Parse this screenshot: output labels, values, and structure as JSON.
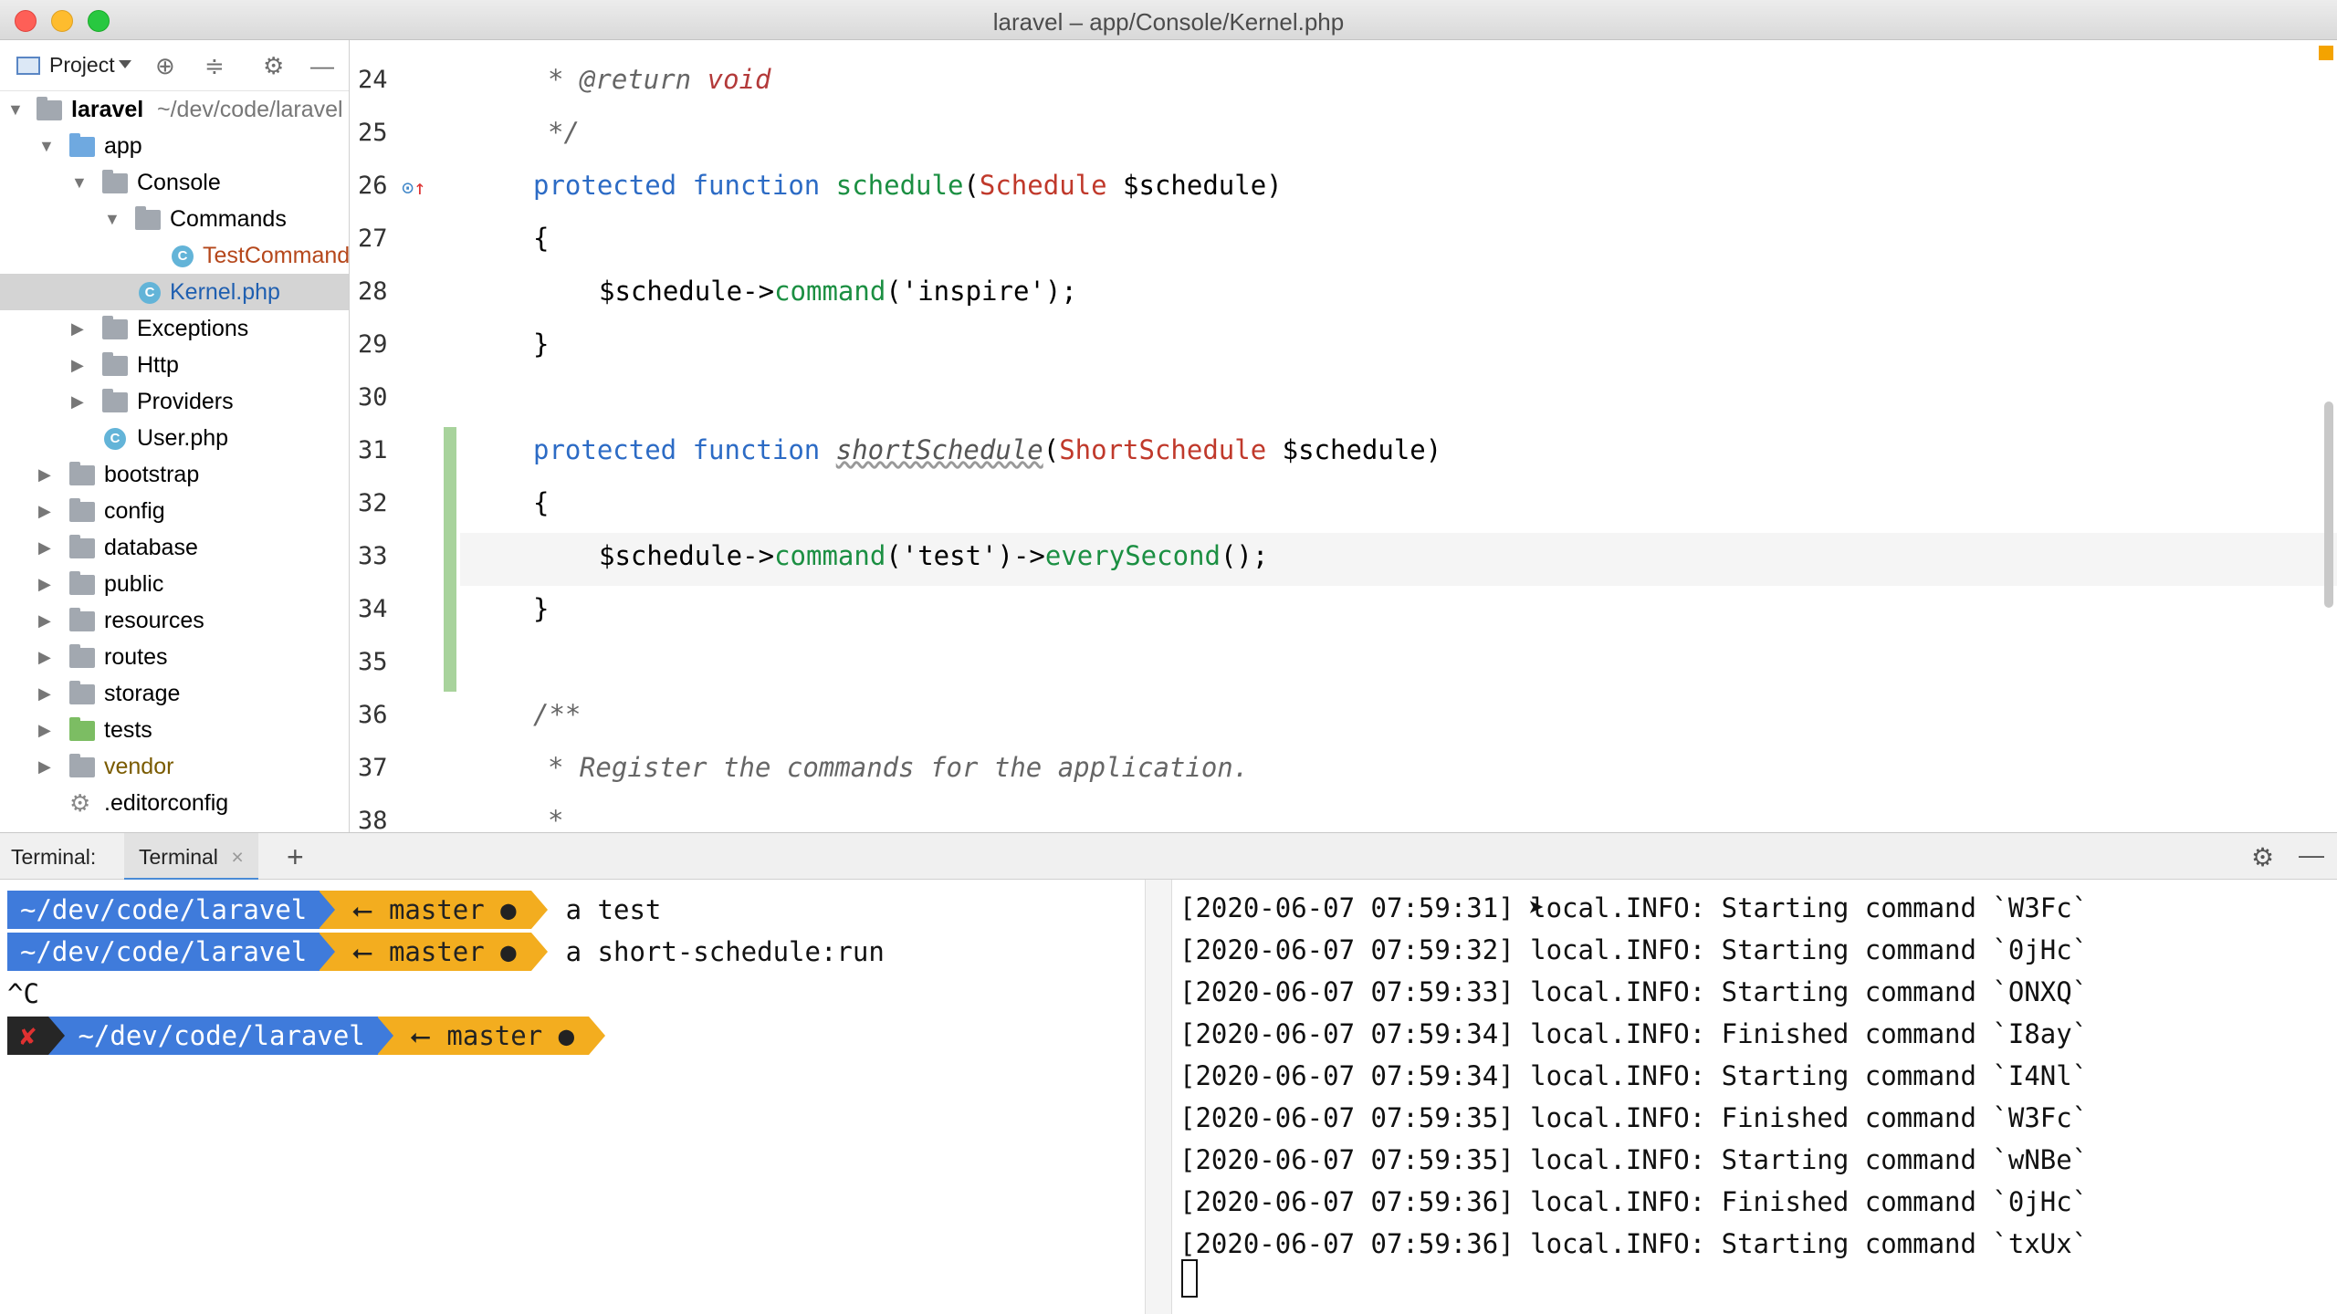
{
  "window": {
    "title": "laravel – app/Console/Kernel.php"
  },
  "sidebar": {
    "view_label": "Project",
    "tree": [
      {
        "label": "laravel",
        "path": "~/dev/code/laravel",
        "type": "root"
      },
      {
        "label": "app"
      },
      {
        "label": "Console"
      },
      {
        "label": "Commands"
      },
      {
        "label": "TestCommand"
      },
      {
        "label": "Kernel.php"
      },
      {
        "label": "Exceptions"
      },
      {
        "label": "Http"
      },
      {
        "label": "Providers"
      },
      {
        "label": "User.php"
      },
      {
        "label": "bootstrap"
      },
      {
        "label": "config"
      },
      {
        "label": "database"
      },
      {
        "label": "public"
      },
      {
        "label": "resources"
      },
      {
        "label": "routes"
      },
      {
        "label": "storage"
      },
      {
        "label": "tests"
      },
      {
        "label": "vendor"
      },
      {
        "label": ".editorconfig"
      }
    ]
  },
  "editor": {
    "line_numbers": [
      "24",
      "25",
      "26",
      "27",
      "28",
      "29",
      "30",
      "31",
      "32",
      "33",
      "34",
      "35",
      "36",
      "37",
      "38"
    ],
    "lines": {
      "l24_star": "* ",
      "l24_tag": "@return ",
      "l24_type": "void",
      "l25": "*/",
      "l26_kw": "protected function ",
      "l26_fn": "schedule",
      "l26_p1": "(",
      "l26_cls": "Schedule",
      "l26_p2": " $schedule)",
      "l27": "{",
      "l28_a": "$schedule->",
      "l28_fn": "command",
      "l28_b": "('inspire');",
      "l29": "}",
      "l31_kw": "protected function ",
      "l31_fn": "shortSchedule",
      "l31_p1": "(",
      "l31_cls": "ShortSchedule",
      "l31_p2": " $schedule)",
      "l32": "{",
      "l33_a": "$schedule->",
      "l33_fn": "command",
      "l33_b": "('test')->",
      "l33_fn2": "everySecond",
      "l33_c": "();",
      "l34": "}",
      "l36": "/**",
      "l37": "* Register the commands for the application.",
      "l38": "*"
    }
  },
  "terminal": {
    "header_label": "Terminal:",
    "tab_label": "Terminal",
    "add_label": "+",
    "left": {
      "path": "~/dev/code/laravel",
      "branch": "⭠ master ●",
      "cmd1": "a test",
      "cmd2": "a short-schedule:run",
      "interrupt": "^C",
      "error_mark": "✘"
    },
    "right_log": [
      "[2020-06-07 07:59:31] local.INFO: Starting command `W3Fc`",
      "[2020-06-07 07:59:32] local.INFO: Starting command `0jHc`",
      "[2020-06-07 07:59:33] local.INFO: Starting command `ONXQ`",
      "[2020-06-07 07:59:34] local.INFO: Finished command `I8ay`",
      "[2020-06-07 07:59:34] local.INFO: Starting command `I4Nl`",
      "[2020-06-07 07:59:35] local.INFO: Finished command `W3Fc`",
      "[2020-06-07 07:59:35] local.INFO: Starting command `wNBe`",
      "[2020-06-07 07:59:36] local.INFO: Finished command `0jHc`",
      "[2020-06-07 07:59:36] local.INFO: Starting command `txUx`"
    ]
  },
  "colors": {
    "keyword": "#2c6bc5",
    "function": "#1b8f42",
    "class": "#c0392b",
    "powerline_blue": "#3f7bdb",
    "powerline_yellow": "#f3ad1f"
  }
}
